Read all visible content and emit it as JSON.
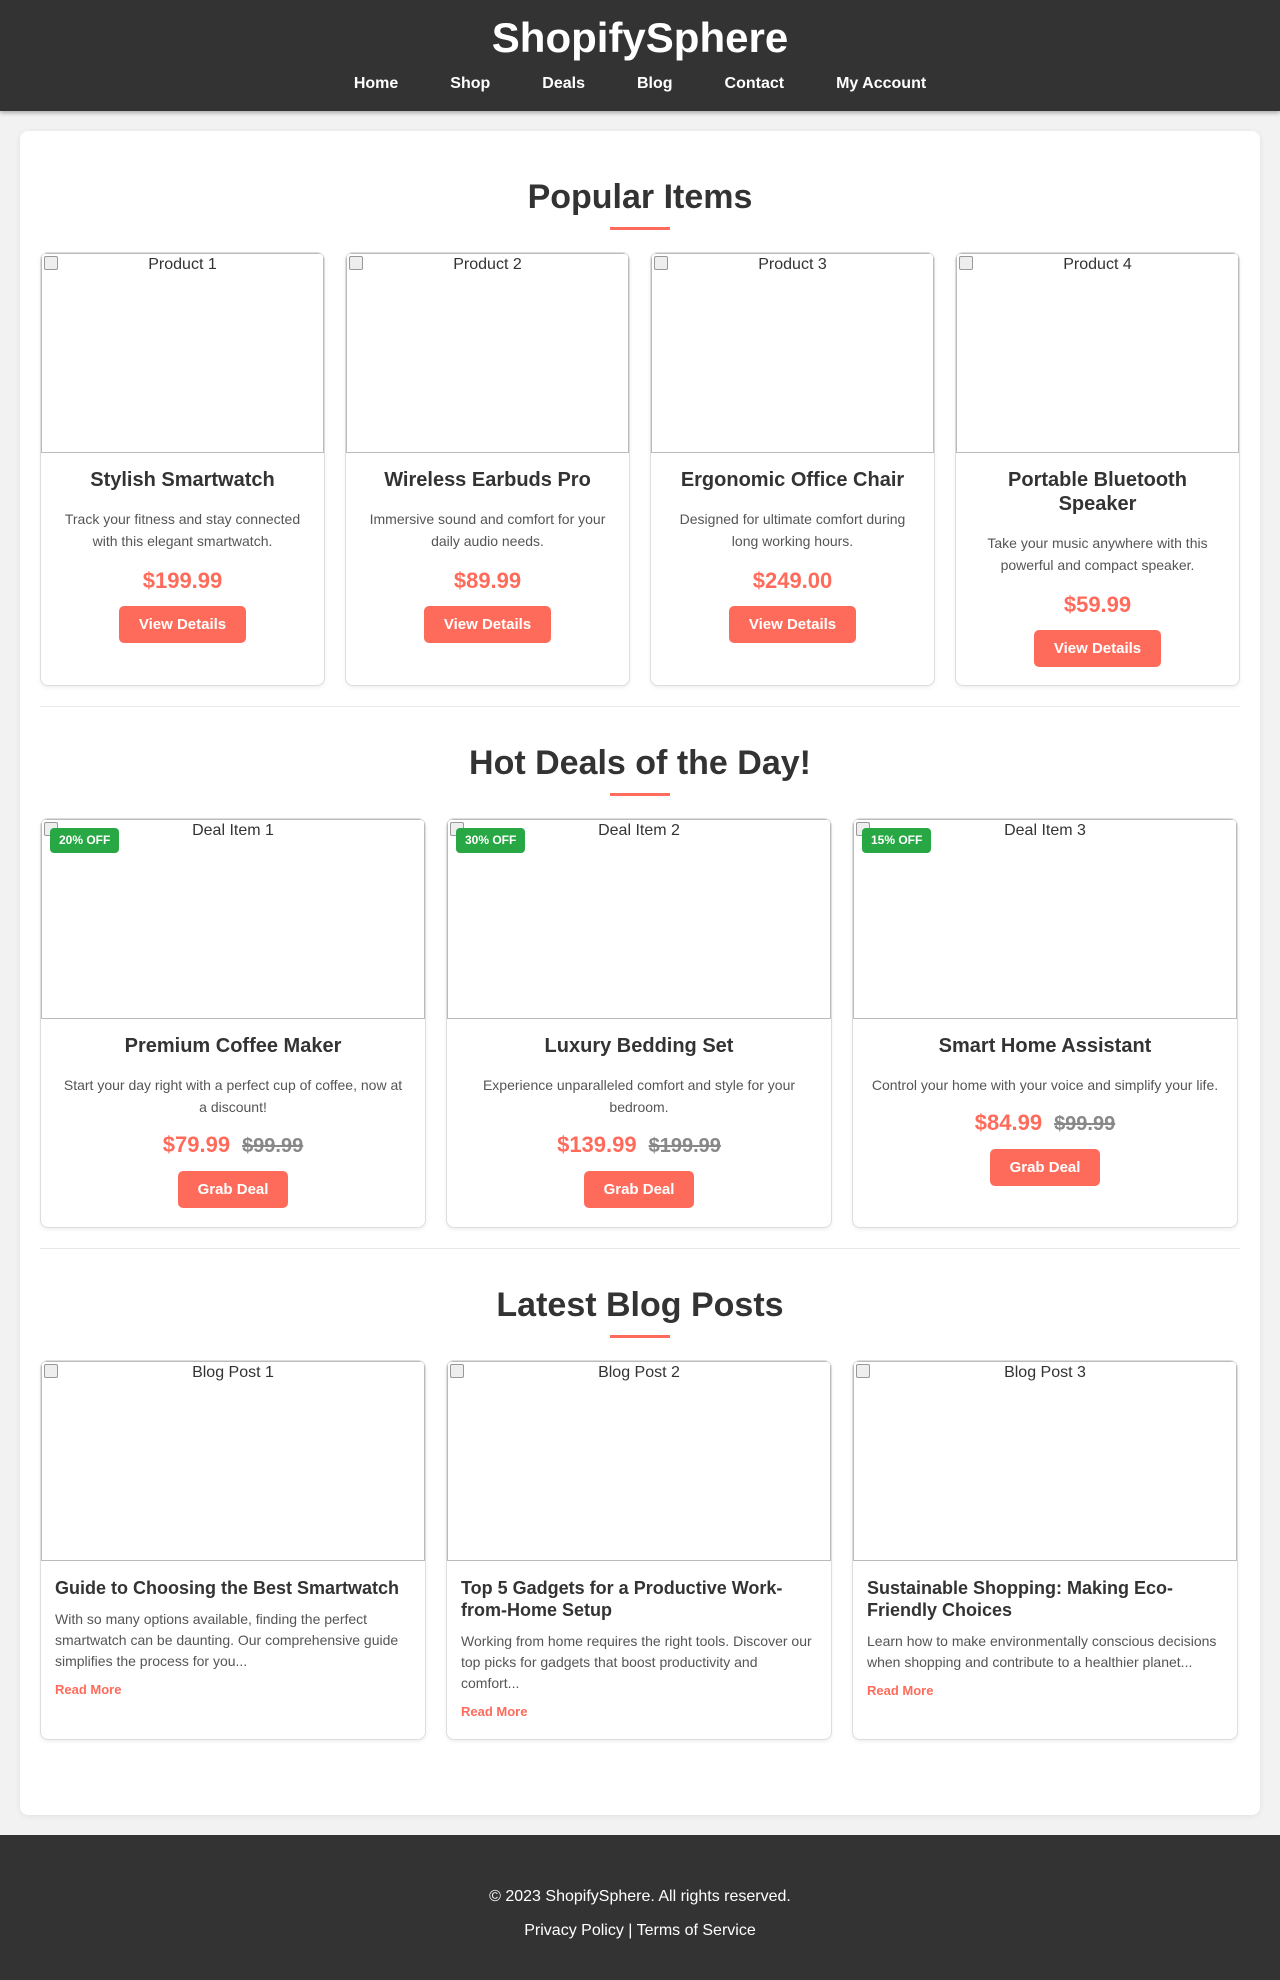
{
  "header": {
    "brand": "ShopifySphere",
    "nav": [
      "Home",
      "Shop",
      "Deals",
      "Blog",
      "Contact",
      "My Account"
    ]
  },
  "popular": {
    "title": "Popular Items",
    "items": [
      {
        "img_alt": "Product 1",
        "name": "Stylish Smartwatch",
        "desc": "Track your fitness and stay connected with this elegant smartwatch.",
        "price": "$199.99",
        "button": "View Details"
      },
      {
        "img_alt": "Product 2",
        "name": "Wireless Earbuds Pro",
        "desc": "Immersive sound and comfort for your daily audio needs.",
        "price": "$89.99",
        "button": "View Details"
      },
      {
        "img_alt": "Product 3",
        "name": "Ergonomic Office Chair",
        "desc": "Designed for ultimate comfort during long working hours.",
        "price": "$249.00",
        "button": "View Details"
      },
      {
        "img_alt": "Product 4",
        "name": "Portable Bluetooth Speaker",
        "desc": "Take your music anywhere with this powerful and compact speaker.",
        "price": "$59.99",
        "button": "View Details"
      }
    ]
  },
  "deals": {
    "title": "Hot Deals of the Day!",
    "items": [
      {
        "img_alt": "Deal Item 1",
        "badge": "20% OFF",
        "name": "Premium Coffee Maker",
        "desc": "Start your day right with a perfect cup of coffee, now at a discount!",
        "price": "$79.99",
        "old_price": "$99.99",
        "button": "Grab Deal"
      },
      {
        "img_alt": "Deal Item 2",
        "badge": "30% OFF",
        "name": "Luxury Bedding Set",
        "desc": "Experience unparalleled comfort and style for your bedroom.",
        "price": "$139.99",
        "old_price": "$199.99",
        "button": "Grab Deal"
      },
      {
        "img_alt": "Deal Item 3",
        "badge": "15% OFF",
        "name": "Smart Home Assistant",
        "desc": "Control your home with your voice and simplify your life.",
        "price": "$84.99",
        "old_price": "$99.99",
        "button": "Grab Deal"
      }
    ]
  },
  "blog": {
    "title": "Latest Blog Posts",
    "posts": [
      {
        "img_alt": "Blog Post 1",
        "title": "Guide to Choosing the Best Smartwatch",
        "excerpt": "With so many options available, finding the perfect smartwatch can be daunting. Our comprehensive guide simplifies the process for you...",
        "link": "Read More"
      },
      {
        "img_alt": "Blog Post 2",
        "title": "Top 5 Gadgets for a Productive Work-from-Home Setup",
        "excerpt": "Working from home requires the right tools. Discover our top picks for gadgets that boost productivity and comfort...",
        "link": "Read More"
      },
      {
        "img_alt": "Blog Post 3",
        "title": "Sustainable Shopping: Making Eco-Friendly Choices",
        "excerpt": "Learn how to make environmentally conscious decisions when shopping and contribute to a healthier planet...",
        "link": "Read More"
      }
    ]
  },
  "footer": {
    "copyright": "© 2023 ShopifySphere. All rights reserved.",
    "privacy": "Privacy Policy",
    "separator": "|",
    "terms": "Terms of Service"
  },
  "colors": {
    "accent": "#ff6b5b",
    "header_bg": "#333333",
    "badge_green": "#28a745"
  }
}
